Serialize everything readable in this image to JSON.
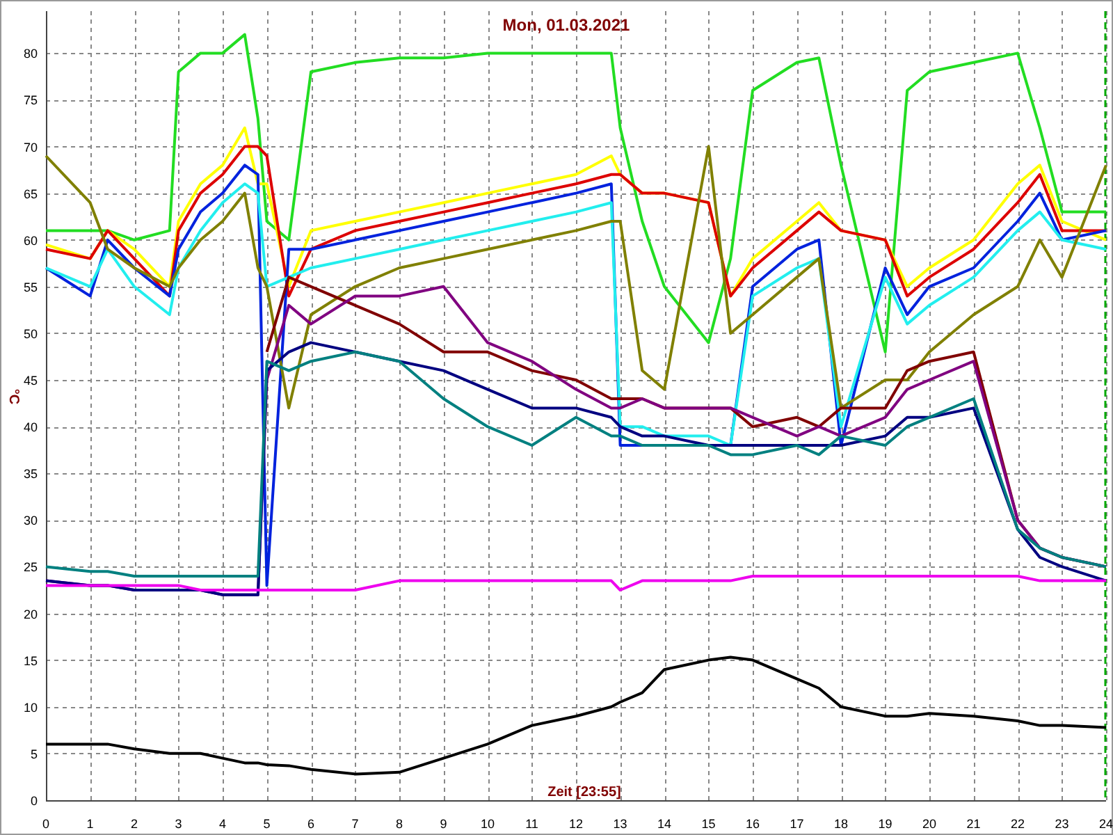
{
  "chart_data": {
    "type": "line",
    "title": "Mon, 01.03.2021",
    "xlabel": "Zeit [23:55]",
    "ylabel": "°C",
    "x": [
      0,
      1,
      1.4,
      2,
      2.8,
      3,
      3.5,
      4,
      4.5,
      4.8,
      5,
      5.5,
      6,
      7,
      8,
      9,
      10,
      11,
      12,
      12.8,
      13,
      13.5,
      14,
      15,
      15.5,
      16,
      17,
      17.5,
      18,
      19,
      19.5,
      20,
      21,
      22,
      22.5,
      23,
      24
    ],
    "xlim": [
      0,
      24
    ],
    "ylim": [
      0,
      84.5
    ],
    "grid": true,
    "xticks": [
      0,
      1,
      2,
      3,
      4,
      5,
      6,
      7,
      8,
      9,
      10,
      11,
      12,
      13,
      14,
      15,
      16,
      17,
      18,
      19,
      20,
      21,
      22,
      23,
      24
    ],
    "yticks": [
      0,
      5,
      10,
      15,
      20,
      25,
      30,
      35,
      40,
      45,
      50,
      55,
      60,
      65,
      70,
      75,
      80
    ],
    "series": [
      {
        "color": "#22dd22",
        "values": [
          61,
          61,
          61,
          60,
          61,
          78,
          80,
          80,
          82,
          73,
          62,
          60,
          78,
          79,
          79.5,
          79.5,
          80,
          80,
          80,
          80,
          72,
          62,
          55,
          49,
          58,
          76,
          79,
          79.5,
          68,
          48,
          76,
          78,
          79,
          80,
          72,
          63,
          63
        ]
      },
      {
        "color": "#ffff00",
        "values": [
          59.5,
          58,
          61,
          59,
          55,
          62,
          66,
          68,
          72,
          66,
          66,
          55,
          61,
          62,
          63,
          64,
          65,
          66,
          67,
          69,
          67,
          65,
          65,
          64,
          54,
          58,
          62,
          64,
          61,
          60,
          55,
          57,
          60,
          66,
          68,
          62,
          60
        ]
      },
      {
        "color": "#dd0000",
        "values": [
          59,
          58,
          61,
          58,
          54,
          61,
          65,
          67,
          70,
          70,
          69,
          54,
          59,
          61,
          62,
          63,
          64,
          65,
          66,
          67,
          67,
          65,
          65,
          64,
          54,
          57,
          61,
          63,
          61,
          60,
          54,
          56,
          59,
          64,
          67,
          61,
          61
        ]
      },
      {
        "color": "#0022dd",
        "values": [
          57,
          54,
          60,
          57,
          54,
          59,
          63,
          65,
          68,
          67,
          23,
          59,
          59,
          60,
          61,
          62,
          63,
          64,
          65,
          66,
          38,
          38,
          38,
          38,
          38,
          55,
          59,
          60,
          38,
          57,
          52,
          55,
          57,
          62,
          65,
          60,
          61
        ]
      },
      {
        "color": "#22eeee",
        "values": [
          57,
          55,
          59,
          55,
          52,
          57,
          61,
          64,
          66,
          65,
          55,
          56,
          57,
          58,
          59,
          60,
          61,
          62,
          63,
          64,
          40,
          40,
          39,
          39,
          38,
          54,
          57,
          58,
          40,
          56,
          51,
          53,
          56,
          61,
          63,
          60,
          59
        ]
      },
      {
        "color": "#808000",
        "values": [
          69,
          64,
          59,
          57,
          55,
          57,
          60,
          62,
          65,
          57,
          55,
          42,
          52,
          55,
          57,
          58,
          59,
          60,
          61,
          62,
          62,
          46,
          44,
          70,
          50,
          52,
          56,
          58,
          42,
          45,
          45,
          48,
          52,
          55,
          60,
          56,
          68
        ]
      },
      {
        "color": "#800000",
        "values": [
          null,
          null,
          null,
          null,
          null,
          null,
          null,
          null,
          null,
          null,
          48,
          56,
          55,
          53,
          51,
          48,
          48,
          46,
          45,
          43,
          43,
          43,
          42,
          42,
          42,
          40,
          41,
          40,
          42,
          42,
          46,
          47,
          48,
          30,
          27,
          26,
          25
        ]
      },
      {
        "color": "#800080",
        "values": [
          23.5,
          23,
          23,
          22.5,
          22.5,
          22.5,
          22.5,
          22,
          22,
          22,
          45,
          53,
          51,
          54,
          54,
          55,
          49,
          47,
          44,
          42,
          42,
          43,
          42,
          42,
          42,
          41,
          39,
          40,
          39,
          41,
          44,
          45,
          47,
          30,
          27,
          26,
          25
        ]
      },
      {
        "color": "#000080",
        "values": [
          23.5,
          23,
          23,
          22.5,
          22.5,
          22.5,
          22.5,
          22,
          22,
          22,
          46,
          48,
          49,
          48,
          47,
          46,
          44,
          42,
          42,
          41,
          40,
          39,
          39,
          38,
          38,
          38,
          38,
          38,
          38,
          39,
          41,
          41,
          42,
          29,
          26,
          25,
          23.5
        ]
      },
      {
        "color": "#008080",
        "values": [
          25,
          24.5,
          24.5,
          24,
          24,
          24,
          24,
          24,
          24,
          24,
          47,
          46,
          47,
          48,
          47,
          43,
          40,
          38,
          41,
          39,
          39,
          38,
          38,
          38,
          37,
          37,
          38,
          37,
          39,
          38,
          40,
          41,
          43,
          29,
          27,
          26,
          25
        ]
      },
      {
        "color": "#ee00ee",
        "values": [
          23,
          23,
          23,
          23,
          23,
          23,
          22.5,
          22.5,
          22.5,
          22.5,
          22.5,
          22.5,
          22.5,
          22.5,
          23.5,
          23.5,
          23.5,
          23.5,
          23.5,
          23.5,
          22.5,
          23.5,
          23.5,
          23.5,
          23.5,
          24,
          24,
          24,
          24,
          24,
          24,
          24,
          24,
          24,
          23.5,
          23.5,
          23.5
        ]
      },
      {
        "color": "#000000",
        "values": [
          6,
          6,
          6,
          5.5,
          5,
          5,
          5,
          4.5,
          4,
          4,
          3.8,
          3.7,
          3.3,
          2.8,
          3,
          4.5,
          6,
          8,
          9,
          10,
          10.5,
          11.5,
          14,
          15,
          15.3,
          15,
          13,
          12,
          10,
          9,
          9,
          9.3,
          9,
          8.5,
          8,
          8,
          7.8
        ]
      }
    ]
  }
}
